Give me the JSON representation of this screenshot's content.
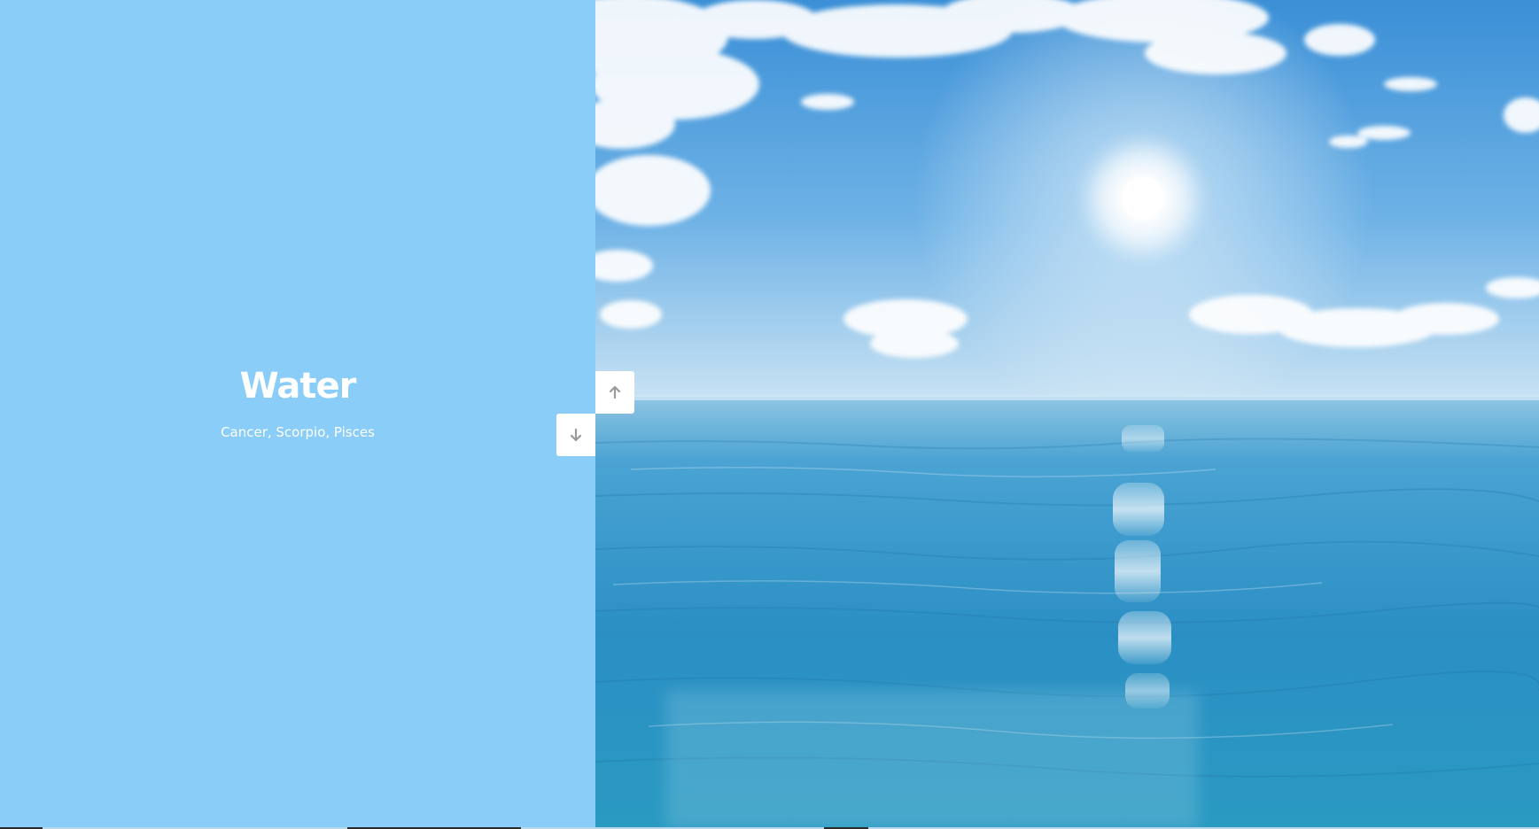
{
  "section": {
    "title": "Water",
    "subtitle": "Cancer, Scorpio, Pisces"
  },
  "nav": {
    "previous_icon": "arrow-up-icon",
    "next_icon": "arrow-down-icon"
  },
  "colors": {
    "panel": "#89cdf8",
    "text": "#ffffff",
    "arrow": "#9a9a9a"
  }
}
